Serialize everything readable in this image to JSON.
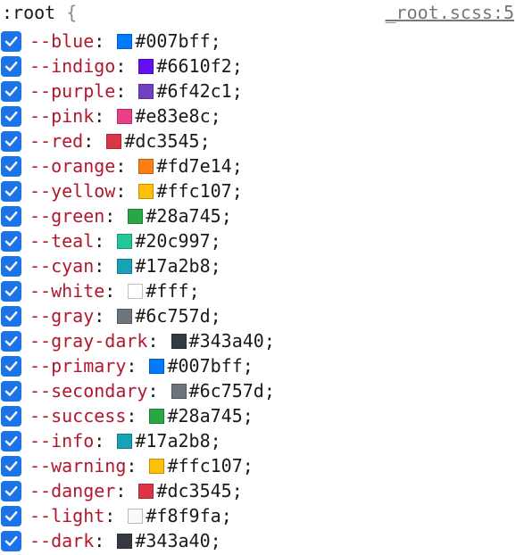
{
  "rule": {
    "selector": ":root",
    "open_brace": "{",
    "source": "_root.scss:5"
  },
  "declarations": [
    {
      "name": "--blue",
      "value": "#007bff",
      "color": "#007bff"
    },
    {
      "name": "--indigo",
      "value": "#6610f2",
      "color": "#6610f2"
    },
    {
      "name": "--purple",
      "value": "#6f42c1",
      "color": "#6f42c1"
    },
    {
      "name": "--pink",
      "value": "#e83e8c",
      "color": "#e83e8c"
    },
    {
      "name": "--red",
      "value": "#dc3545",
      "color": "#dc3545"
    },
    {
      "name": "--orange",
      "value": "#fd7e14",
      "color": "#fd7e14"
    },
    {
      "name": "--yellow",
      "value": "#ffc107",
      "color": "#ffc107"
    },
    {
      "name": "--green",
      "value": "#28a745",
      "color": "#28a745"
    },
    {
      "name": "--teal",
      "value": "#20c997",
      "color": "#20c997"
    },
    {
      "name": "--cyan",
      "value": "#17a2b8",
      "color": "#17a2b8"
    },
    {
      "name": "--white",
      "value": "#fff",
      "color": "#ffffff"
    },
    {
      "name": "--gray",
      "value": "#6c757d",
      "color": "#6c757d"
    },
    {
      "name": "--gray-dark",
      "value": "#343a40",
      "color": "#343a40"
    },
    {
      "name": "--primary",
      "value": "#007bff",
      "color": "#007bff"
    },
    {
      "name": "--secondary",
      "value": "#6c757d",
      "color": "#6c757d"
    },
    {
      "name": "--success",
      "value": "#28a745",
      "color": "#28a745"
    },
    {
      "name": "--info",
      "value": "#17a2b8",
      "color": "#17a2b8"
    },
    {
      "name": "--warning",
      "value": "#ffc107",
      "color": "#ffc107"
    },
    {
      "name": "--danger",
      "value": "#dc3545",
      "color": "#dc3545"
    },
    {
      "name": "--light",
      "value": "#f8f9fa",
      "color": "#f8f9fa"
    },
    {
      "name": "--dark",
      "value": "#343a40",
      "color": "#343a40"
    }
  ],
  "colors": {
    "checkbox": "#1a73e8",
    "property": "#b0182f"
  },
  "icons": {
    "checkbox": "checkmark-icon"
  }
}
